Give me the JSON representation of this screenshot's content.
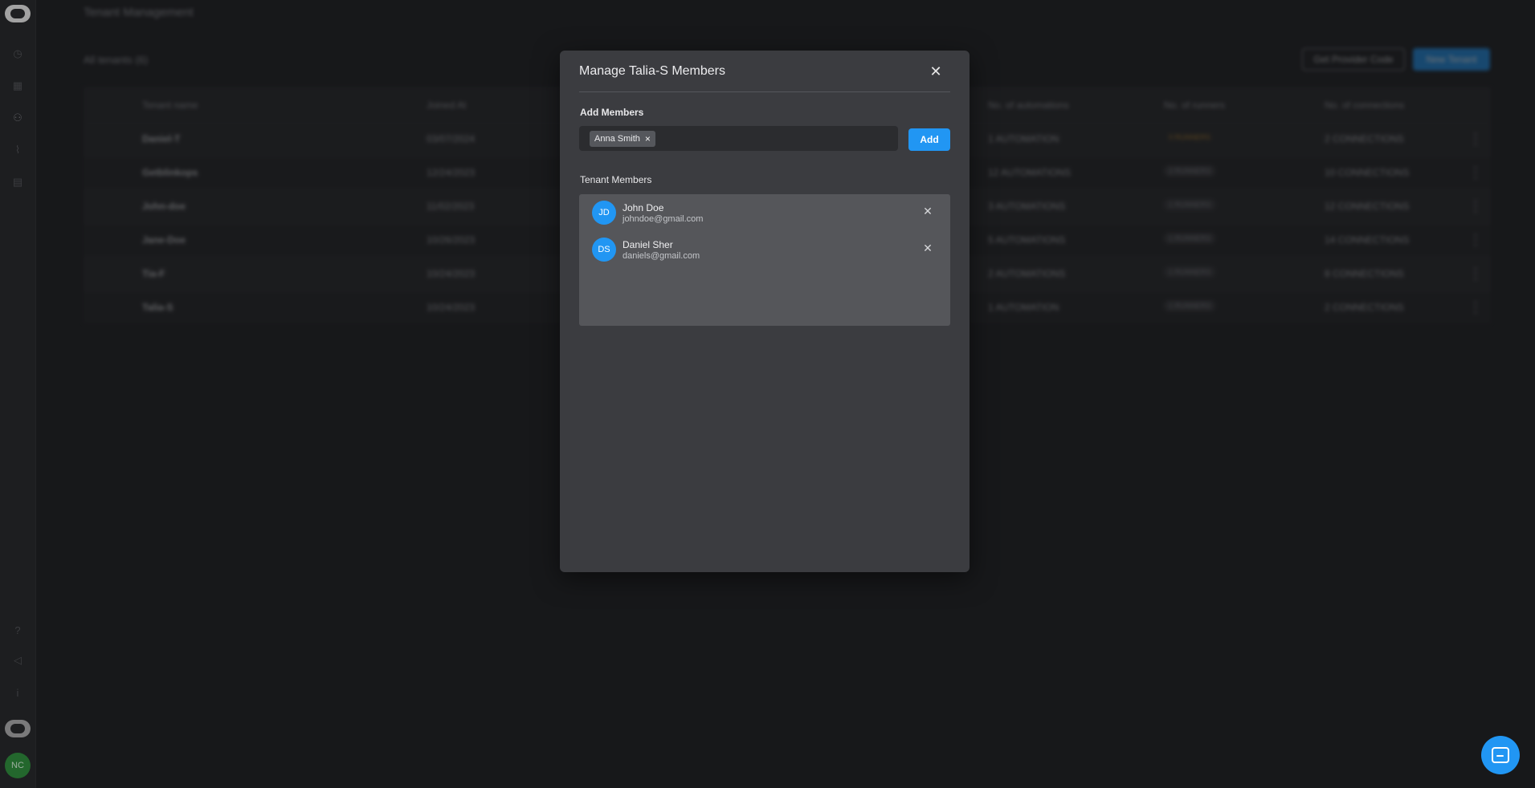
{
  "background_page": {
    "title": "Tenant Management",
    "tenant_count": "All tenants (6)",
    "provider_button": "Get Provider Code",
    "new_button": "New Tenant",
    "columns": [
      "Tenant name",
      "Joined At",
      "No. of automations",
      "No. of runners",
      "No. of connections"
    ],
    "rows": [
      {
        "name": "Daniel-T",
        "joined": "03/07/2024",
        "automations": "1 AUTOMATION",
        "runners": "0 RUNNERS",
        "connections": "2 CONNECTIONS"
      },
      {
        "name": "Getblinkops",
        "joined": "12/24/2023",
        "automations": "12 AUTOMATIONS",
        "runners": "2 RUNNERS",
        "connections": "10 CONNECTIONS"
      },
      {
        "name": "John-doe",
        "joined": "11/02/2023",
        "automations": "3 AUTOMATIONS",
        "runners": "1 RUNNERS",
        "connections": "12 CONNECTIONS"
      },
      {
        "name": "Jane-Doe",
        "joined": "10/26/2023",
        "automations": "5 AUTOMATIONS",
        "runners": "1 RUNNERS",
        "connections": "14 CONNECTIONS"
      },
      {
        "name": "Tia-F",
        "joined": "10/24/2023",
        "automations": "2 AUTOMATIONS",
        "runners": "1 RUNNERS",
        "connections": "8 CONNECTIONS"
      },
      {
        "name": "Talia-S",
        "joined": "10/24/2023",
        "automations": "1 AUTOMATION",
        "runners": "1 RUNNERS",
        "connections": "2 CONNECTIONS"
      }
    ]
  },
  "modal": {
    "title": "Manage Talia-S Members",
    "add_members_label": "Add Members",
    "selected_chip": "Anna Smith",
    "add_button": "Add",
    "tenant_members_label": "Tenant Members",
    "members": [
      {
        "initials": "JD",
        "name": "John Doe",
        "email": "johndoe@gmail.com"
      },
      {
        "initials": "DS",
        "name": "Daniel Sher",
        "email": "daniels@gmail.com"
      }
    ]
  },
  "user": {
    "initials": "NC"
  },
  "colors": {
    "accent": "#2196f3",
    "modal_bg": "#3b3c40",
    "page_bg": "#1f2023",
    "warning": "#c58b2a"
  }
}
